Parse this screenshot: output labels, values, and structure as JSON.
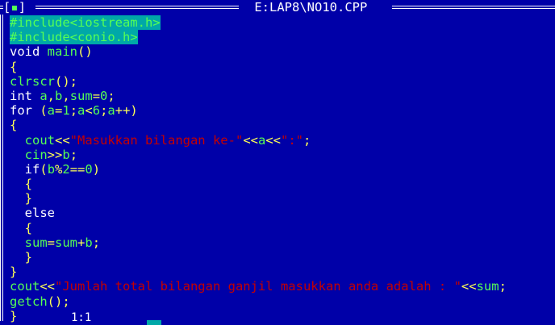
{
  "window": {
    "title": " E:LAP8\\NO10.CPP ",
    "close_box_left": "[",
    "close_box_dot": "▪",
    "close_box_right": "]"
  },
  "status": {
    "cursor_pos": "1:1"
  },
  "code": [
    [
      [
        "#include<iostream.h>",
        "ins"
      ]
    ],
    [
      [
        "#include<conio.h>",
        "ins"
      ]
    ],
    [
      [
        "void ",
        "kw"
      ],
      [
        "main",
        "id"
      ],
      [
        "()",
        "sym"
      ]
    ],
    [
      [
        "{",
        "sym"
      ]
    ],
    [
      [
        "clrscr",
        "id"
      ],
      [
        "();",
        "sym"
      ]
    ],
    [
      [
        "int ",
        "kw"
      ],
      [
        "a",
        "id"
      ],
      [
        ",",
        "sym"
      ],
      [
        "b",
        "id"
      ],
      [
        ",",
        "sym"
      ],
      [
        "sum",
        "id"
      ],
      [
        "=",
        "sym"
      ],
      [
        "0",
        "num"
      ],
      [
        ";",
        "sym"
      ]
    ],
    [
      [
        "for ",
        "kw"
      ],
      [
        "(",
        "sym"
      ],
      [
        "a",
        "id"
      ],
      [
        "=",
        "sym"
      ],
      [
        "1",
        "num"
      ],
      [
        ";",
        "sym"
      ],
      [
        "a",
        "id"
      ],
      [
        "<",
        "sym"
      ],
      [
        "6",
        "num"
      ],
      [
        ";",
        "sym"
      ],
      [
        "a",
        "id"
      ],
      [
        "++)",
        "sym"
      ]
    ],
    [
      [
        "{",
        "sym"
      ]
    ],
    [
      [
        "  ",
        ""
      ],
      [
        "cout",
        "id"
      ],
      [
        "<<",
        "sym"
      ],
      [
        "\"Masukkan bilangan ke-\"",
        "str"
      ],
      [
        "<<",
        "sym"
      ],
      [
        "a",
        "id"
      ],
      [
        "<<",
        "sym"
      ],
      [
        "\":\"",
        "str"
      ],
      [
        ";",
        "sym"
      ]
    ],
    [
      [
        "  ",
        ""
      ],
      [
        "cin",
        "id"
      ],
      [
        ">>",
        "sym"
      ],
      [
        "b",
        "id"
      ],
      [
        ";",
        "sym"
      ]
    ],
    [
      [
        "  ",
        ""
      ],
      [
        "if",
        "kw"
      ],
      [
        "(",
        "sym"
      ],
      [
        "b",
        "id"
      ],
      [
        "%",
        "sym"
      ],
      [
        "2",
        "num"
      ],
      [
        "==",
        "sym"
      ],
      [
        "0",
        "num"
      ],
      [
        ")",
        "sym"
      ]
    ],
    [
      [
        "  ",
        ""
      ],
      [
        "{",
        "sym"
      ]
    ],
    [
      [
        "  ",
        ""
      ],
      [
        "}",
        "sym"
      ]
    ],
    [
      [
        "  ",
        ""
      ],
      [
        "else",
        "kw"
      ]
    ],
    [
      [
        "  ",
        ""
      ],
      [
        "{",
        "sym"
      ]
    ],
    [
      [
        "  ",
        ""
      ],
      [
        "sum",
        "id"
      ],
      [
        "=",
        "sym"
      ],
      [
        "sum",
        "id"
      ],
      [
        "+",
        "sym"
      ],
      [
        "b",
        "id"
      ],
      [
        ";",
        "sym"
      ]
    ],
    [
      [
        "  ",
        ""
      ],
      [
        "}",
        "sym"
      ]
    ],
    [
      [
        "}",
        "sym"
      ]
    ],
    [
      [
        "cout",
        "id"
      ],
      [
        "<<",
        "sym"
      ],
      [
        "\"Jumlah total bilangan ganjil masukkan anda adalah : \"",
        "str"
      ],
      [
        "<<",
        "sym"
      ],
      [
        "sum",
        "id"
      ],
      [
        ";",
        "sym"
      ]
    ],
    [
      [
        "getch",
        "id"
      ],
      [
        "();",
        "sym"
      ]
    ],
    [
      [
        "}",
        "sym"
      ]
    ]
  ]
}
